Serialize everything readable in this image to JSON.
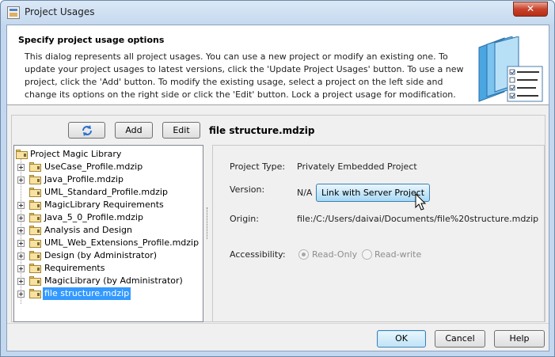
{
  "window": {
    "title": "Project Usages",
    "close_glyph": "✕"
  },
  "header": {
    "title": "Specify project usage options",
    "description": "This dialog represents all project usages. You can use a new project or modify an existing one. To update your project usages to latest versions, click the 'Update Project Usages' button. To use a new project, click the 'Add' button. To modify the existing usage, select a project on the left side and change its options on the right side or click the 'Edit' button. Lock a project usage for modification."
  },
  "toolbar": {
    "refresh_icon": "refresh-icon",
    "add_label": "Add",
    "edit_label": "Edit",
    "selected_file": "file structure.mdzip"
  },
  "tree": {
    "root": "Project Magic Library",
    "items": [
      {
        "label": "UseCase_Profile.mdzip",
        "expandable": true
      },
      {
        "label": "Java_Profile.mdzip",
        "expandable": true
      },
      {
        "label": "UML_Standard_Profile.mdzip",
        "expandable": false
      },
      {
        "label": "MagicLibrary Requirements",
        "expandable": true
      },
      {
        "label": "Java_5_0_Profile.mdzip",
        "expandable": true
      },
      {
        "label": "Analysis and Design",
        "expandable": true
      },
      {
        "label": "UML_Web_Extensions_Profile.mdzip",
        "expandable": true
      },
      {
        "label": "Design (by Administrator)",
        "expandable": true
      },
      {
        "label": "Requirements",
        "expandable": true
      },
      {
        "label": "MagicLibrary (by Administrator)",
        "expandable": true
      },
      {
        "label": "file structure.mdzip",
        "expandable": true,
        "selected": true
      }
    ]
  },
  "properties": {
    "project_type_label": "Project Type:",
    "project_type_value": "Privately Embedded Project",
    "version_label": "Version:",
    "version_value": "N/A",
    "link_button_label": "Link with Server Project",
    "origin_label": "Origin:",
    "origin_value": "file:/C:/Users/daivai/Documents/file%20structure.mdzip",
    "accessibility_label": "Accessibility:",
    "read_only_label": "Read-Only",
    "read_write_label": "Read-write",
    "read_only_checked": true
  },
  "footer": {
    "ok_label": "OK",
    "cancel_label": "Cancel",
    "help_label": "Help"
  },
  "colors": {
    "selection": "#3399ff",
    "accent": "#3c7fb1"
  }
}
